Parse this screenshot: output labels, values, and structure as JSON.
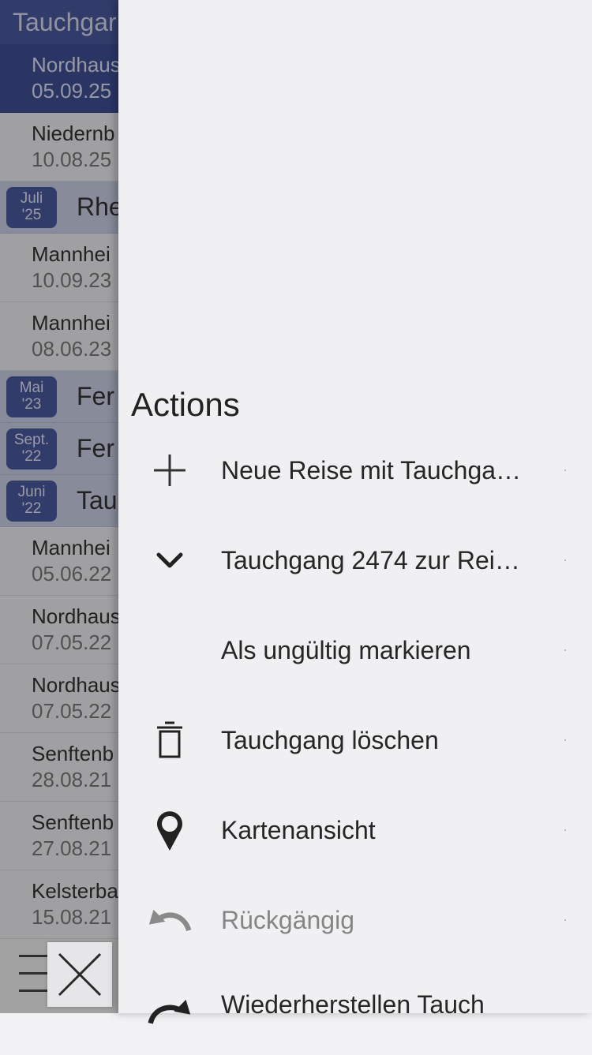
{
  "background": {
    "header_title": "Tauchgar",
    "rows": [
      {
        "kind": "dive",
        "location": "Nordhaus",
        "date": "05.09.25",
        "selected": true
      },
      {
        "kind": "dive",
        "location": "Niedernb",
        "date": "10.08.25"
      },
      {
        "kind": "trip",
        "month": "Juli",
        "year": "'25",
        "title": "Rhe"
      },
      {
        "kind": "dive",
        "location": "Mannhei",
        "date": "10.09.23"
      },
      {
        "kind": "dive",
        "location": "Mannhei",
        "date": "08.06.23"
      },
      {
        "kind": "trip",
        "month": "Mai",
        "year": "'23",
        "title": "Fer"
      },
      {
        "kind": "trip",
        "month": "Sept.",
        "year": "'22",
        "title": "Fer"
      },
      {
        "kind": "trip",
        "month": "Juni",
        "year": "'22",
        "title": "Tau"
      },
      {
        "kind": "dive",
        "location": "Mannhei",
        "date": "05.06.22"
      },
      {
        "kind": "dive",
        "location": "Nordhaus",
        "date": "07.05.22"
      },
      {
        "kind": "dive",
        "location": "Nordhaus",
        "date": "07.05.22"
      },
      {
        "kind": "dive",
        "location": "Senftenb",
        "date": "28.08.21"
      },
      {
        "kind": "dive",
        "location": "Senftenb",
        "date": "27.08.21"
      },
      {
        "kind": "dive",
        "location": "Kelsterba",
        "date": "15.08.21"
      }
    ]
  },
  "drawer": {
    "title": "Actions",
    "actions": [
      {
        "icon": "plus-icon",
        "label": "Neue Reise mit Tauchga…",
        "disabled": false
      },
      {
        "icon": "chevron-down-icon",
        "label": "Tauchgang 2474 zur Rei…",
        "disabled": false
      },
      {
        "icon": "",
        "label": "Als ungültig markieren",
        "disabled": false
      },
      {
        "icon": "trash-icon",
        "label": "Tauchgang löschen",
        "disabled": false
      },
      {
        "icon": "map-pin-icon",
        "label": "Kartenansicht",
        "disabled": false
      },
      {
        "icon": "undo-icon",
        "label": "Rückgängig",
        "disabled": true
      },
      {
        "icon": "redo-icon",
        "label": "Wiederherstellen Tauch",
        "disabled": false
      }
    ]
  },
  "controls": {
    "menu_icon": "hamburger-icon",
    "close_icon": "close-icon"
  }
}
